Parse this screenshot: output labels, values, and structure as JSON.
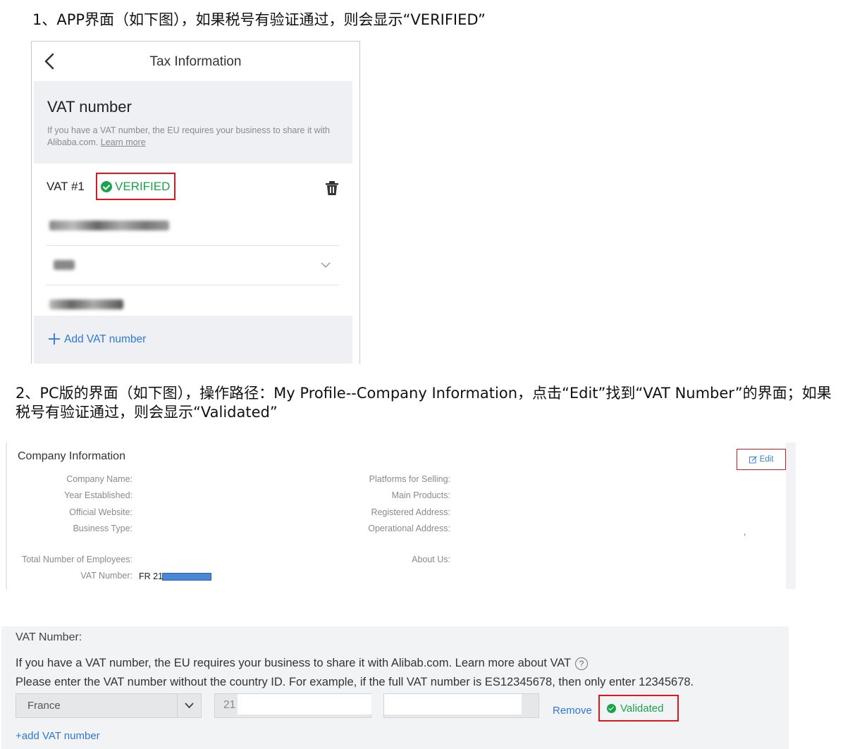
{
  "headings": {
    "app": "1、APP界面（如下图），如果税号有验证通过，则会显示“VERIFIED”",
    "pc": "2、PC版的界面（如下图），操作路径：My Profile--Company Information，点击“Edit”找到“VAT Number”的界面；如果税号有验证通过，则会显示“Validated”"
  },
  "app": {
    "title": "Tax Information",
    "section_title": "VAT number",
    "description": "If you have a VAT number, the EU requires your business to share it with Alibaba.com.",
    "learn_more": "Learn more",
    "vat_label": "VAT #1",
    "verified": "VERIFIED",
    "add_vat": "Add VAT number",
    "colors": {
      "verified": "#1aa34a",
      "link": "#2e78d2",
      "highlight": "#e0161b"
    }
  },
  "company": {
    "title": "Company Information",
    "edit": "Edit",
    "left_labels": [
      "Company Name:",
      "Year Established:",
      "Official Website:",
      "Business Type:"
    ],
    "right_labels": [
      "Platforms for Selling:",
      "Main Products:",
      "Registered Address:",
      "Operational Address:"
    ],
    "employees_label": "Total Number of Employees:",
    "about_label": "About Us:",
    "vat_label": "VAT Number:",
    "vat_value": "FR 21",
    "comma": ","
  },
  "vat_form": {
    "title": "VAT Number:",
    "line1": "If you have a VAT number, the EU requires your business to share it with Alibab.com. Learn more about VAT",
    "help_icon": "?",
    "line2": "Please enter the VAT number without the country ID. For example, if the full VAT number is ES12345678, then only enter 12345678.",
    "country": "France",
    "vat_prefix": "21",
    "remove": "Remove",
    "validated": "Validated",
    "add": "+add VAT number"
  }
}
